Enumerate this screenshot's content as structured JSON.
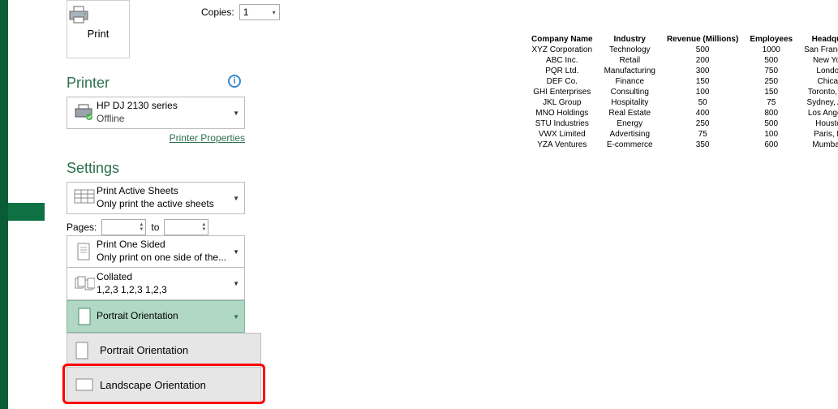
{
  "print_button": {
    "label": "Print"
  },
  "copies": {
    "label": "Copies:",
    "value": "1"
  },
  "printer_section": {
    "heading": "Printer",
    "selected_name": "HP DJ 2130 series",
    "selected_status": "Offline",
    "properties_link": "Printer Properties"
  },
  "settings_section": {
    "heading": "Settings",
    "print_what": {
      "title": "Print Active Sheets",
      "sub": "Only print the active sheets"
    },
    "pages_label": "Pages:",
    "pages_from": "",
    "pages_to_label": "to",
    "pages_to": "",
    "sides": {
      "title": "Print One Sided",
      "sub": "Only print on one side of the..."
    },
    "collation": {
      "title": "Collated",
      "sub": "1,2,3   1,2,3   1,2,3"
    },
    "orientation_selected": "Portrait Orientation",
    "orientation_options": [
      "Portrait Orientation",
      "Landscape Orientation"
    ]
  },
  "preview_table": {
    "headers": [
      "Company Name",
      "Industry",
      "Revenue (Millions)",
      "Employees",
      "Headquarters"
    ],
    "rows": [
      [
        "XYZ Corporation",
        "Technology",
        "500",
        "1000",
        "San Francisco, CA"
      ],
      [
        "ABC Inc.",
        "Retail",
        "200",
        "500",
        "New York, NY"
      ],
      [
        "PQR Ltd.",
        "Manufacturing",
        "300",
        "750",
        "London, UK"
      ],
      [
        "DEF Co.",
        "Finance",
        "150",
        "250",
        "Chicago, IL"
      ],
      [
        "GHI Enterprises",
        "Consulting",
        "100",
        "150",
        "Toronto, Canada"
      ],
      [
        "JKL Group",
        "Hospitality",
        "50",
        "75",
        "Sydney, Australia"
      ],
      [
        "MNO Holdings",
        "Real Estate",
        "400",
        "800",
        "Los Angeles, CA"
      ],
      [
        "STU Industries",
        "Energy",
        "250",
        "500",
        "Houston, TX"
      ],
      [
        "VWX Limited",
        "Advertising",
        "75",
        "100",
        "Paris, France"
      ],
      [
        "YZA Ventures",
        "E-commerce",
        "350",
        "600",
        "Mumbai, India"
      ]
    ]
  }
}
